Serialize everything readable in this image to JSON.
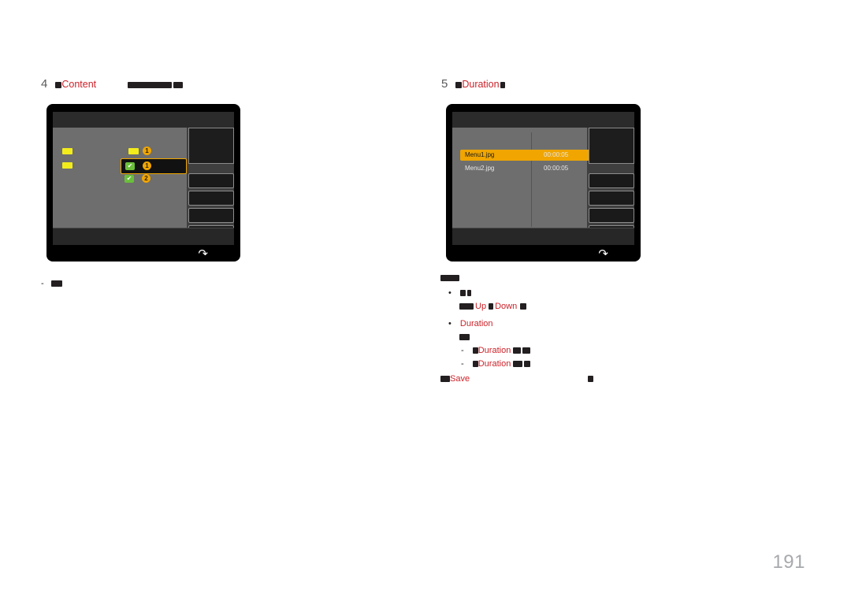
{
  "page": {
    "number": "191"
  },
  "steps": [
    {
      "id": "step-4",
      "number": "4",
      "text_before": "",
      "keyword": "Content",
      "text_after": ""
    },
    {
      "id": "step-5",
      "number": "5",
      "text_before": "",
      "keyword": "Duration",
      "text_after": ""
    }
  ],
  "figure_left": {
    "name": "content-selection-screen",
    "rows": [
      {
        "check": "✔",
        "number": "1",
        "selected": false
      },
      {
        "check": "✔",
        "number": "1",
        "selected": true
      },
      {
        "check": "✔",
        "number": "2",
        "selected": false
      }
    ]
  },
  "figure_right": {
    "name": "duration-list-screen",
    "columns": [
      "file",
      "duration"
    ],
    "files": [
      {
        "name": "Menu1.jpg",
        "duration": "00:00:05",
        "selected": true
      },
      {
        "name": "Menu2.jpg",
        "duration": "00:00:05",
        "selected": false
      }
    ]
  },
  "notes": {
    "left_caption": "",
    "right_heading": "",
    "bullets": [
      {
        "id": "bullet-1",
        "line1": "",
        "line2_pre": "",
        "line2_up": "Up",
        "line2_mid": "",
        "line2_down": "Down",
        "line2_post": ""
      },
      {
        "id": "bullet-2",
        "label": "Duration",
        "line2": "",
        "sub": [
          {
            "id": "sub-1",
            "label": "Duration",
            "text": ""
          },
          {
            "id": "sub-2",
            "label": "Duration",
            "text": ""
          }
        ]
      }
    ],
    "footer": {
      "label": "Save",
      "text": ""
    }
  }
}
